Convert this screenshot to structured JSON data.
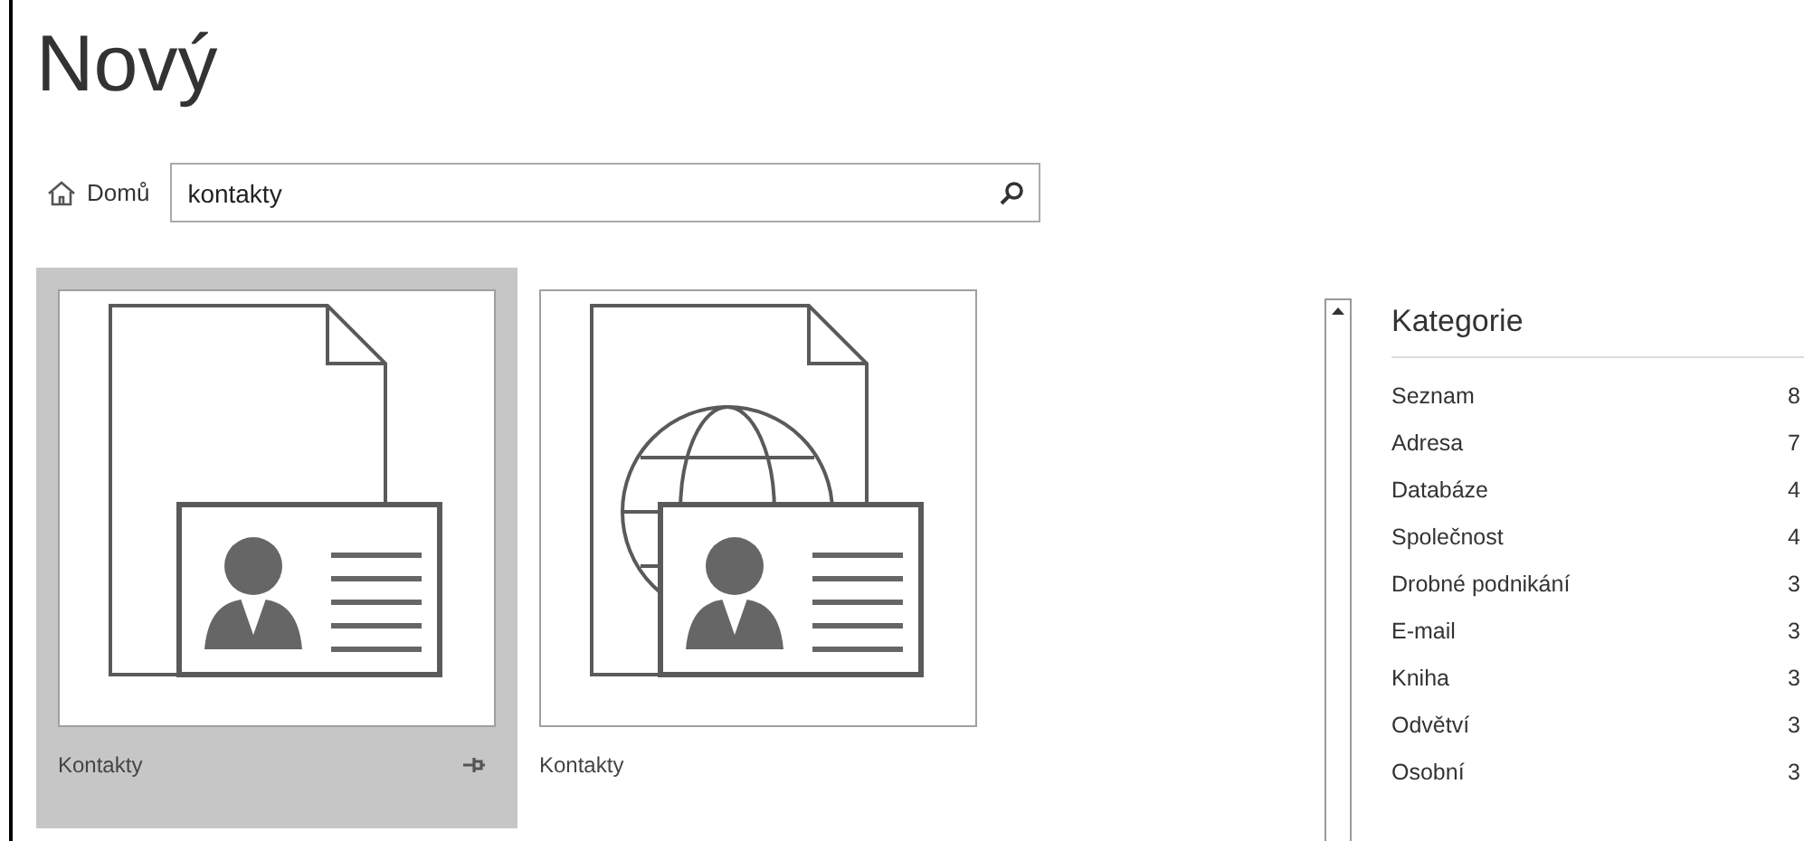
{
  "title": "Nový",
  "nav": {
    "home": "Domů"
  },
  "search": {
    "value": "kontakty"
  },
  "templates": [
    {
      "label": "Kontakty",
      "kind": "plain",
      "selected": true
    },
    {
      "label": "Kontakty",
      "kind": "web",
      "selected": false
    }
  ],
  "categories": {
    "title": "Kategorie",
    "items": [
      {
        "name": "Seznam",
        "count": "8"
      },
      {
        "name": "Adresa",
        "count": "7"
      },
      {
        "name": "Databáze",
        "count": "4"
      },
      {
        "name": "Společnost",
        "count": "4"
      },
      {
        "name": "Drobné podnikání",
        "count": "3"
      },
      {
        "name": "E-mail",
        "count": "3"
      },
      {
        "name": "Kniha",
        "count": "3"
      },
      {
        "name": "Odvětví",
        "count": "3"
      },
      {
        "name": "Osobní",
        "count": "3"
      }
    ]
  }
}
